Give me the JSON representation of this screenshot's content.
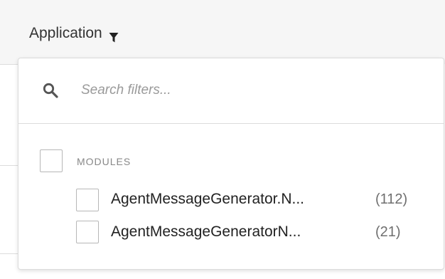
{
  "column_header": {
    "label": "Application",
    "icon": "filter-icon"
  },
  "filter_panel": {
    "search": {
      "icon": "search-icon",
      "placeholder": "Search filters...",
      "value": ""
    },
    "group": {
      "label": "MODULES",
      "checked": false,
      "items": [
        {
          "label": "AgentMessageGenerator.N...",
          "count": "(112)",
          "checked": false
        },
        {
          "label": "AgentMessageGeneratorN...",
          "count": "(21)",
          "checked": false
        }
      ]
    }
  },
  "colors": {
    "header_background": "#f6f6f6",
    "border": "#dcdcdc",
    "placeholder": "#9a9a9a",
    "muted_text": "#888888"
  }
}
